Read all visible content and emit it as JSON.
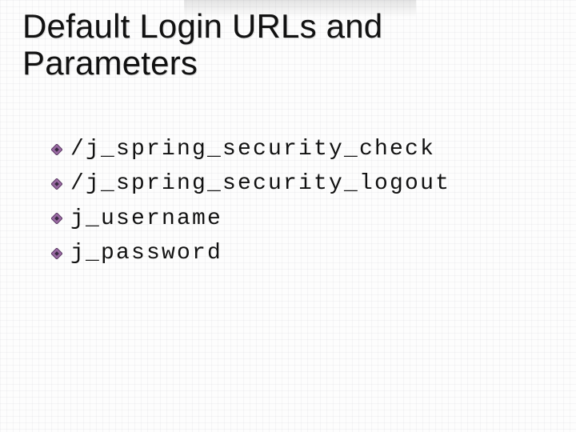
{
  "slide": {
    "title": "Default Login URLs and Parameters",
    "bullets": [
      "/j_spring_security_check",
      "/j_spring_security_logout",
      "j_username",
      "j_password"
    ]
  },
  "icons": {
    "bullet": "diamond-bullet-icon"
  }
}
